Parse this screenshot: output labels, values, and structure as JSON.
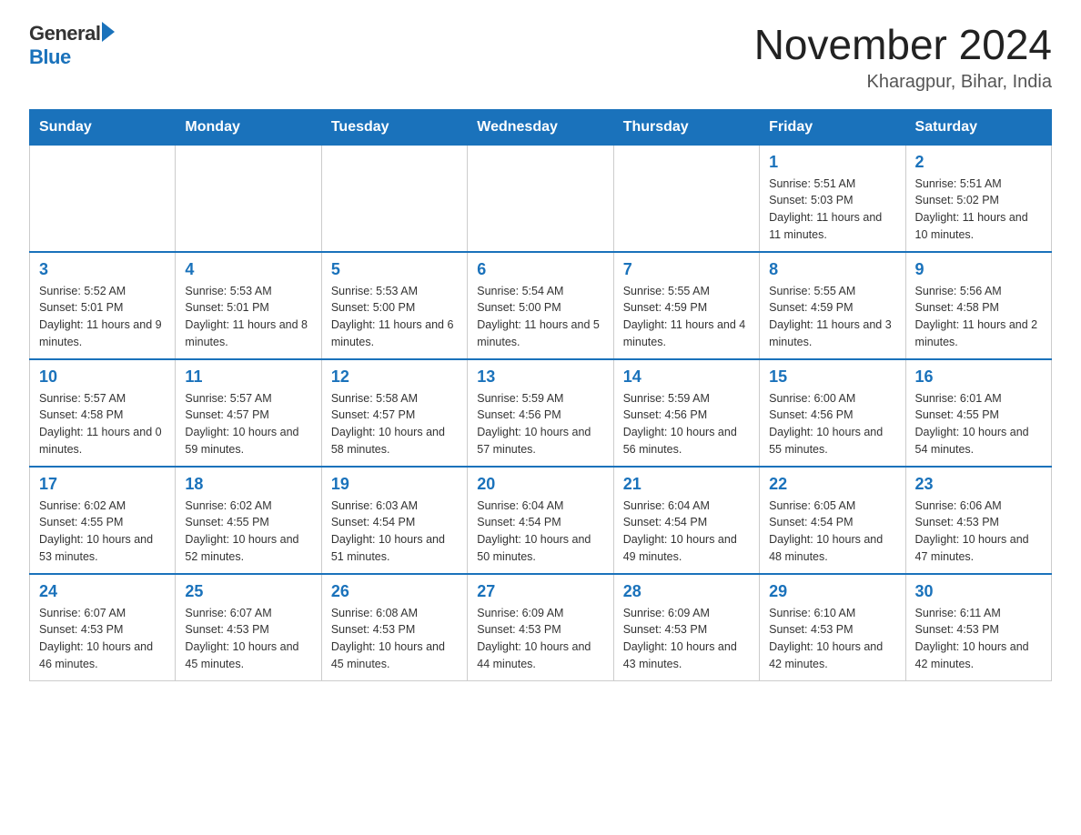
{
  "header": {
    "logo_general": "General",
    "logo_blue": "Blue",
    "month_title": "November 2024",
    "location": "Kharagpur, Bihar, India"
  },
  "weekdays": [
    "Sunday",
    "Monday",
    "Tuesday",
    "Wednesday",
    "Thursday",
    "Friday",
    "Saturday"
  ],
  "weeks": [
    [
      {
        "day": "",
        "info": ""
      },
      {
        "day": "",
        "info": ""
      },
      {
        "day": "",
        "info": ""
      },
      {
        "day": "",
        "info": ""
      },
      {
        "day": "",
        "info": ""
      },
      {
        "day": "1",
        "info": "Sunrise: 5:51 AM\nSunset: 5:03 PM\nDaylight: 11 hours and 11 minutes."
      },
      {
        "day": "2",
        "info": "Sunrise: 5:51 AM\nSunset: 5:02 PM\nDaylight: 11 hours and 10 minutes."
      }
    ],
    [
      {
        "day": "3",
        "info": "Sunrise: 5:52 AM\nSunset: 5:01 PM\nDaylight: 11 hours and 9 minutes."
      },
      {
        "day": "4",
        "info": "Sunrise: 5:53 AM\nSunset: 5:01 PM\nDaylight: 11 hours and 8 minutes."
      },
      {
        "day": "5",
        "info": "Sunrise: 5:53 AM\nSunset: 5:00 PM\nDaylight: 11 hours and 6 minutes."
      },
      {
        "day": "6",
        "info": "Sunrise: 5:54 AM\nSunset: 5:00 PM\nDaylight: 11 hours and 5 minutes."
      },
      {
        "day": "7",
        "info": "Sunrise: 5:55 AM\nSunset: 4:59 PM\nDaylight: 11 hours and 4 minutes."
      },
      {
        "day": "8",
        "info": "Sunrise: 5:55 AM\nSunset: 4:59 PM\nDaylight: 11 hours and 3 minutes."
      },
      {
        "day": "9",
        "info": "Sunrise: 5:56 AM\nSunset: 4:58 PM\nDaylight: 11 hours and 2 minutes."
      }
    ],
    [
      {
        "day": "10",
        "info": "Sunrise: 5:57 AM\nSunset: 4:58 PM\nDaylight: 11 hours and 0 minutes."
      },
      {
        "day": "11",
        "info": "Sunrise: 5:57 AM\nSunset: 4:57 PM\nDaylight: 10 hours and 59 minutes."
      },
      {
        "day": "12",
        "info": "Sunrise: 5:58 AM\nSunset: 4:57 PM\nDaylight: 10 hours and 58 minutes."
      },
      {
        "day": "13",
        "info": "Sunrise: 5:59 AM\nSunset: 4:56 PM\nDaylight: 10 hours and 57 minutes."
      },
      {
        "day": "14",
        "info": "Sunrise: 5:59 AM\nSunset: 4:56 PM\nDaylight: 10 hours and 56 minutes."
      },
      {
        "day": "15",
        "info": "Sunrise: 6:00 AM\nSunset: 4:56 PM\nDaylight: 10 hours and 55 minutes."
      },
      {
        "day": "16",
        "info": "Sunrise: 6:01 AM\nSunset: 4:55 PM\nDaylight: 10 hours and 54 minutes."
      }
    ],
    [
      {
        "day": "17",
        "info": "Sunrise: 6:02 AM\nSunset: 4:55 PM\nDaylight: 10 hours and 53 minutes."
      },
      {
        "day": "18",
        "info": "Sunrise: 6:02 AM\nSunset: 4:55 PM\nDaylight: 10 hours and 52 minutes."
      },
      {
        "day": "19",
        "info": "Sunrise: 6:03 AM\nSunset: 4:54 PM\nDaylight: 10 hours and 51 minutes."
      },
      {
        "day": "20",
        "info": "Sunrise: 6:04 AM\nSunset: 4:54 PM\nDaylight: 10 hours and 50 minutes."
      },
      {
        "day": "21",
        "info": "Sunrise: 6:04 AM\nSunset: 4:54 PM\nDaylight: 10 hours and 49 minutes."
      },
      {
        "day": "22",
        "info": "Sunrise: 6:05 AM\nSunset: 4:54 PM\nDaylight: 10 hours and 48 minutes."
      },
      {
        "day": "23",
        "info": "Sunrise: 6:06 AM\nSunset: 4:53 PM\nDaylight: 10 hours and 47 minutes."
      }
    ],
    [
      {
        "day": "24",
        "info": "Sunrise: 6:07 AM\nSunset: 4:53 PM\nDaylight: 10 hours and 46 minutes."
      },
      {
        "day": "25",
        "info": "Sunrise: 6:07 AM\nSunset: 4:53 PM\nDaylight: 10 hours and 45 minutes."
      },
      {
        "day": "26",
        "info": "Sunrise: 6:08 AM\nSunset: 4:53 PM\nDaylight: 10 hours and 45 minutes."
      },
      {
        "day": "27",
        "info": "Sunrise: 6:09 AM\nSunset: 4:53 PM\nDaylight: 10 hours and 44 minutes."
      },
      {
        "day": "28",
        "info": "Sunrise: 6:09 AM\nSunset: 4:53 PM\nDaylight: 10 hours and 43 minutes."
      },
      {
        "day": "29",
        "info": "Sunrise: 6:10 AM\nSunset: 4:53 PM\nDaylight: 10 hours and 42 minutes."
      },
      {
        "day": "30",
        "info": "Sunrise: 6:11 AM\nSunset: 4:53 PM\nDaylight: 10 hours and 42 minutes."
      }
    ]
  ]
}
